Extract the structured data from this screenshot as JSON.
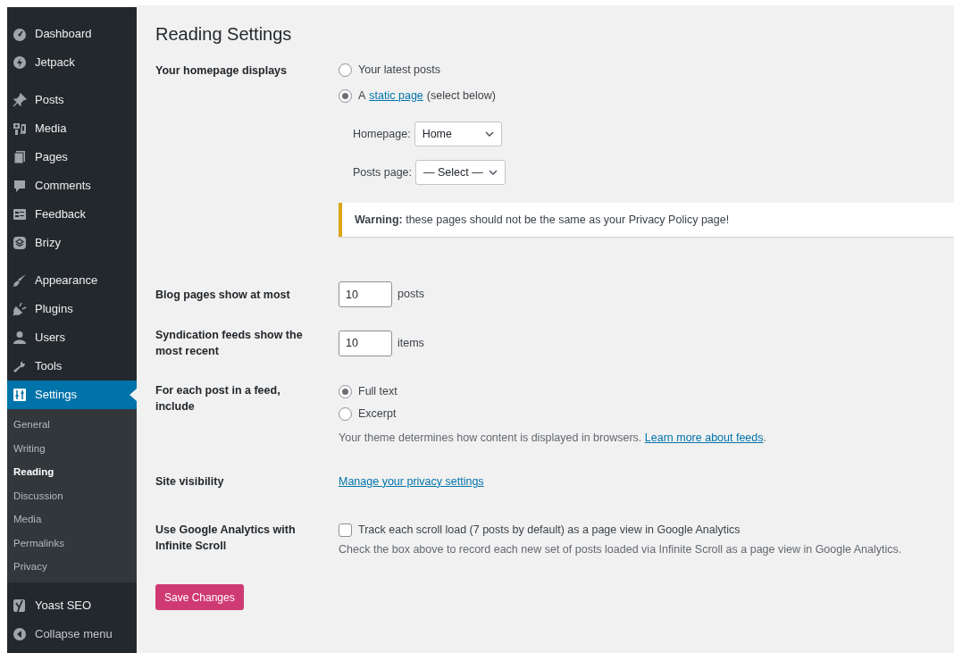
{
  "sidebar": {
    "groups": [
      {
        "items": [
          {
            "label": "Dashboard",
            "kind": "gauge",
            "selected": false
          },
          {
            "label": "Jetpack",
            "kind": "bolt",
            "selected": false
          }
        ]
      },
      {
        "items": [
          {
            "label": "Posts",
            "kind": "pin",
            "selected": false
          },
          {
            "label": "Media",
            "kind": "media",
            "selected": false
          },
          {
            "label": "Pages",
            "kind": "pages",
            "selected": false
          },
          {
            "label": "Comments",
            "kind": "bubble",
            "selected": false
          },
          {
            "label": "Feedback",
            "kind": "form",
            "selected": false
          },
          {
            "label": "Brizy",
            "kind": "layers",
            "selected": false
          }
        ]
      },
      {
        "items": [
          {
            "label": "Appearance",
            "kind": "brush",
            "selected": false
          },
          {
            "label": "Plugins",
            "kind": "plug",
            "selected": false
          },
          {
            "label": "Users",
            "kind": "user",
            "selected": false
          },
          {
            "label": "Tools",
            "kind": "wrench",
            "selected": false
          },
          {
            "label": "Settings",
            "kind": "sliders",
            "selected": true,
            "submenu": [
              {
                "label": "General",
                "selected": false
              },
              {
                "label": "Writing",
                "selected": false
              },
              {
                "label": "Reading",
                "selected": true
              },
              {
                "label": "Discussion",
                "selected": false
              },
              {
                "label": "Media",
                "selected": false
              },
              {
                "label": "Permalinks",
                "selected": false
              },
              {
                "label": "Privacy",
                "selected": false
              }
            ]
          }
        ]
      },
      {
        "items": [
          {
            "label": "Yoast SEO",
            "kind": "yoast",
            "selected": false
          },
          {
            "label": "Collapse menu",
            "kind": "collapse",
            "selected": false
          }
        ]
      }
    ]
  },
  "title": "Reading Settings",
  "rows": [
    {
      "kind": "homepage",
      "label": "Your homepage displays",
      "options": [
        {
          "text": "Your latest posts",
          "selected": false
        },
        {
          "prefix": "A",
          "link": "static page",
          "suffix": "(select below)",
          "selected": true
        }
      ],
      "selects": [
        {
          "label": "Homepage:",
          "value": "Home"
        },
        {
          "label": "Posts page:",
          "value": "— Select —"
        }
      ],
      "notice": "**Warning:** these pages should not be the same as your Privacy Policy page!"
    },
    {
      "kind": "number",
      "label": "Blog pages show at most",
      "value": "10",
      "unit": "posts"
    },
    {
      "kind": "number",
      "label": "Syndication feeds show the most recent",
      "value": "10",
      "unit": "items"
    },
    {
      "kind": "radios",
      "label": "For each post in a feed, include",
      "options": [
        {
          "text": "Full text",
          "selected": true
        },
        {
          "text": "Excerpt",
          "selected": false
        }
      ],
      "description": "Your theme determines how content is displayed in browsers.",
      "link": "Learn more about feeds",
      "end": "."
    },
    {
      "kind": "link",
      "label": "Site visibility",
      "link": "Manage your privacy settings"
    },
    {
      "kind": "checkbox",
      "label": "Use Google Analytics with Infinite Scroll",
      "checkbox": {
        "text": "Track each scroll load (7 posts by default) as a page view in Google Analytics",
        "checked": false
      },
      "description": "Check the box above to record each new set of posts loaded via Infinite Scroll as a page view in Google Analytics."
    }
  ],
  "save_button": "Save Changes"
}
